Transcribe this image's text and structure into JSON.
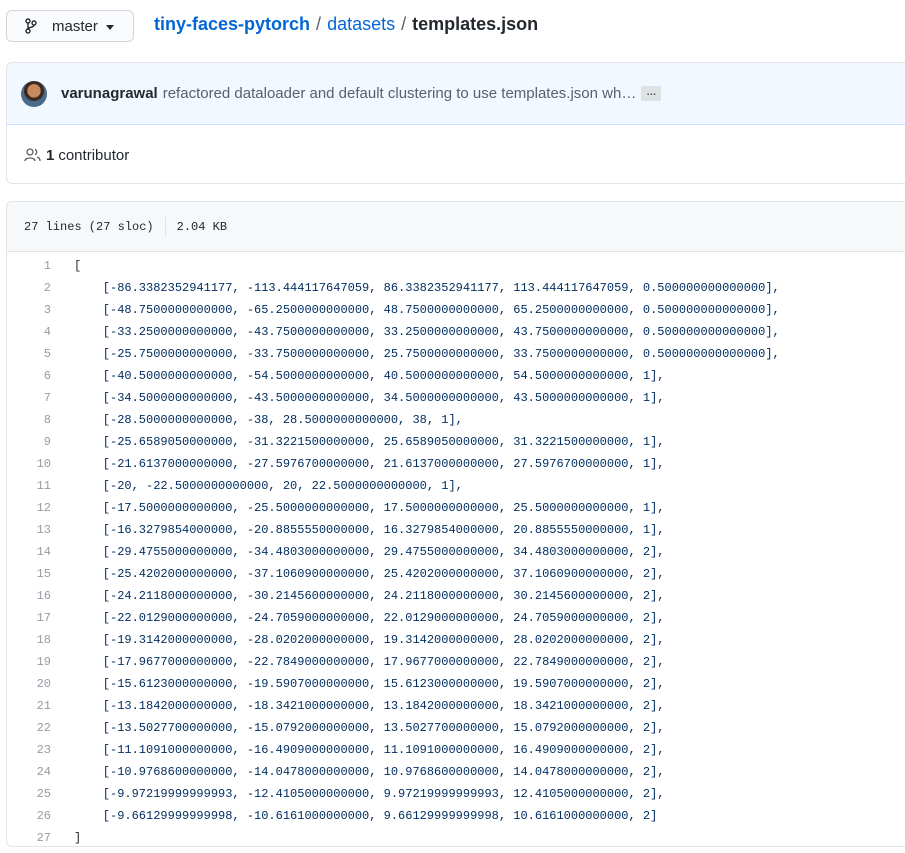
{
  "branch": {
    "label": "master"
  },
  "breadcrumb": {
    "repo": "tiny-faces-pytorch",
    "separator": "/",
    "folder": "datasets",
    "file": "templates.json"
  },
  "commit": {
    "author": "varunagrawal",
    "message": "refactored dataloader and default clustering to use templates.json wh…",
    "ellipsis": "…"
  },
  "contributors": {
    "count": "1",
    "label": "contributor"
  },
  "file_info": {
    "lines": "27 lines (27 sloc)",
    "size": "2.04 KB"
  },
  "code_lines": [
    "[",
    "    [-86.3382352941177, -113.444117647059, 86.3382352941177, 113.444117647059, 0.500000000000000],",
    "    [-48.7500000000000, -65.2500000000000, 48.7500000000000, 65.2500000000000, 0.500000000000000],",
    "    [-33.2500000000000, -43.7500000000000, 33.2500000000000, 43.7500000000000, 0.500000000000000],",
    "    [-25.7500000000000, -33.7500000000000, 25.7500000000000, 33.7500000000000, 0.500000000000000],",
    "    [-40.5000000000000, -54.5000000000000, 40.5000000000000, 54.5000000000000, 1],",
    "    [-34.5000000000000, -43.5000000000000, 34.5000000000000, 43.5000000000000, 1],",
    "    [-28.5000000000000, -38, 28.5000000000000, 38, 1],",
    "    [-25.6589050000000, -31.3221500000000, 25.6589050000000, 31.3221500000000, 1],",
    "    [-21.6137000000000, -27.5976700000000, 21.6137000000000, 27.5976700000000, 1],",
    "    [-20, -22.5000000000000, 20, 22.5000000000000, 1],",
    "    [-17.5000000000000, -25.5000000000000, 17.5000000000000, 25.5000000000000, 1],",
    "    [-16.3279854000000, -20.8855550000000, 16.3279854000000, 20.8855550000000, 1],",
    "    [-29.4755000000000, -34.4803000000000, 29.4755000000000, 34.4803000000000, 2],",
    "    [-25.4202000000000, -37.1060900000000, 25.4202000000000, 37.1060900000000, 2],",
    "    [-24.2118000000000, -30.2145600000000, 24.2118000000000, 30.2145600000000, 2],",
    "    [-22.0129000000000, -24.7059000000000, 22.0129000000000, 24.7059000000000, 2],",
    "    [-19.3142000000000, -28.0202000000000, 19.3142000000000, 28.0202000000000, 2],",
    "    [-17.9677000000000, -22.7849000000000, 17.9677000000000, 22.7849000000000, 2],",
    "    [-15.6123000000000, -19.5907000000000, 15.6123000000000, 19.5907000000000, 2],",
    "    [-13.1842000000000, -18.3421000000000, 13.1842000000000, 18.3421000000000, 2],",
    "    [-13.5027700000000, -15.0792000000000, 13.5027700000000, 15.0792000000000, 2],",
    "    [-11.1091000000000, -16.4909000000000, 11.1091000000000, 16.4909000000000, 2],",
    "    [-10.9768600000000, -14.0478000000000, 10.9768600000000, 14.0478000000000, 2],",
    "    [-9.97219999999993, -12.4105000000000, 9.97219999999993, 12.4105000000000, 2],",
    "    [-9.66129999999998, -10.6161000000000, 9.66129999999998, 10.6161000000000, 2]",
    "]"
  ],
  "icons": {
    "branch": "git-branch-icon",
    "caret": "caret-down-icon",
    "people": "people-icon",
    "avatar": "user-avatar"
  },
  "colors": {
    "link": "#0366d6",
    "code_text": "#032f62",
    "line_number": "#959da5",
    "commit_bg": "#f1f8ff"
  }
}
